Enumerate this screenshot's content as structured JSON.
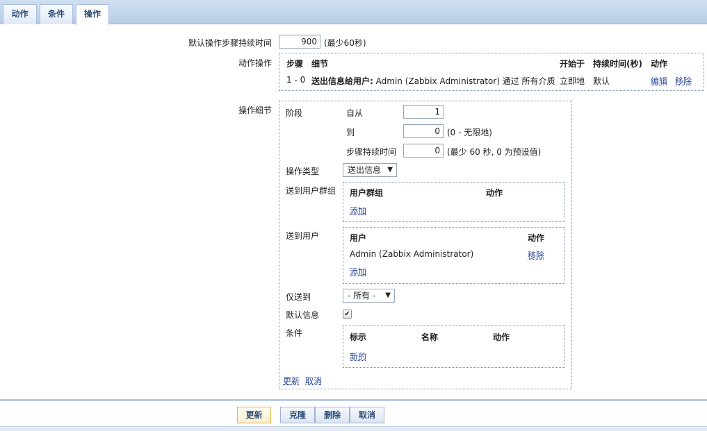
{
  "tabs": [
    {
      "label": "动作"
    },
    {
      "label": "条件"
    },
    {
      "label": "操作"
    }
  ],
  "form": {
    "default_step_duration": {
      "label": "默认操作步骤持续时间",
      "value": "900",
      "hint": "(最少60秒)"
    },
    "action_operations": {
      "label": "动作操作",
      "headers": {
        "step": "步骤",
        "details": "细节",
        "start_in": "开始于",
        "duration": "持续时间(秒)",
        "action": "动作"
      },
      "row": {
        "step": "1 - 0",
        "details_bold": "送出信息给用户:",
        "details_rest": "Admin (Zabbix Administrator) 通过 所有介质",
        "start_in": "立即地",
        "duration": "默认",
        "edit": "编辑",
        "remove": "移除"
      }
    },
    "operation_details": {
      "label": "操作细节",
      "step_label": "阶段",
      "from_label": "自从",
      "from_value": "1",
      "to_label": "到",
      "to_value": "0",
      "to_hint": "(0 - 无限地)",
      "step_duration_label": "步骤持续时间",
      "step_duration_value": "0",
      "step_duration_hint": "(最少 60 秒, 0 为预设值)",
      "op_type_label": "操作类型",
      "op_type_value": "送出信息",
      "send_to_groups": {
        "label": "送到用户群组",
        "col_group": "用户群组",
        "col_action": "动作",
        "add": "添加"
      },
      "send_to_users": {
        "label": "送到用户",
        "col_user": "用户",
        "col_action": "动作",
        "users": [
          {
            "name": "Admin (Zabbix Administrator)",
            "remove": "移除"
          }
        ],
        "add": "添加"
      },
      "send_only_to_label": "仅送到",
      "send_only_to_value": "- 所有 -",
      "default_message_label": "默认信息",
      "default_message_checked": true,
      "conditions": {
        "label": "条件",
        "col_label": "标示",
        "col_name": "名称",
        "col_action": "动作",
        "new": "新的"
      },
      "update_link": "更新",
      "cancel_link": "取消"
    }
  },
  "footer": {
    "update": "更新",
    "clone": "克隆",
    "delete": "删除",
    "cancel": "取消"
  },
  "colors": {
    "accent": "#2b4a78",
    "link": "#2b4a9a",
    "primary_button_border": "#e2b44a"
  }
}
